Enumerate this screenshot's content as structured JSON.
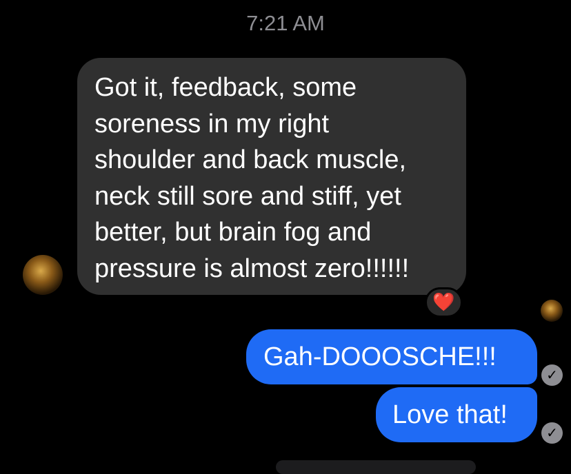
{
  "conversation": {
    "timestamp": "7:21 AM",
    "incoming_message": {
      "lines": [
        "Got it, feedback, some",
        "soreness in my right",
        "shoulder and back muscle,",
        "neck still sore and stiff, yet",
        "better, but brain fog and",
        "pressure is almost zero!!!!!!"
      ],
      "reaction": "❤️"
    },
    "outgoing_messages": [
      {
        "text": "Gah-DOOOSCHE!!!",
        "receipt_icon": "✓"
      },
      {
        "text": "Love that!",
        "receipt_icon": "✓"
      }
    ]
  },
  "theme": {
    "background": "#000000",
    "incoming_bubble": "#303030",
    "outgoing_bubble": "#1f6bf5",
    "timestamp_color": "#8e8e93",
    "receipt_color": "#8e8e93",
    "reaction_color": "#ff2d3a"
  }
}
